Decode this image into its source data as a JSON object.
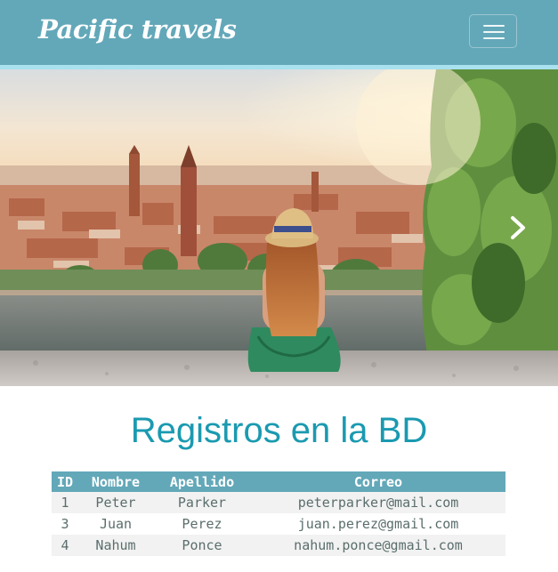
{
  "navbar": {
    "brand": "Pacific travels",
    "toggle_icon": "hamburger-menu-icon"
  },
  "carousel": {
    "image_alt": "Woman in a hat sitting on a wall overlooking a historic city by a river",
    "next_icon": "chevron-right-icon"
  },
  "section": {
    "title": "Registros en la BD"
  },
  "table": {
    "headers": [
      "ID",
      "Nombre",
      "Apellido",
      "Correo"
    ],
    "rows": [
      {
        "id": "1",
        "nombre": "Peter",
        "apellido": "Parker",
        "correo": "peterparker@mail.com"
      },
      {
        "id": "3",
        "nombre": "Juan",
        "apellido": "Perez",
        "correo": "juan.perez@gmail.com"
      },
      {
        "id": "4",
        "nombre": "Nahum",
        "apellido": "Ponce",
        "correo": "nahum.ponce@gmail.com"
      }
    ]
  },
  "colors": {
    "navbar": "#63a8b9",
    "navbar_stripe": "#a9e1ef",
    "title": "#1a9ab0",
    "table_header": "#63a8b9",
    "row_stripe": "#f2f2f2"
  }
}
